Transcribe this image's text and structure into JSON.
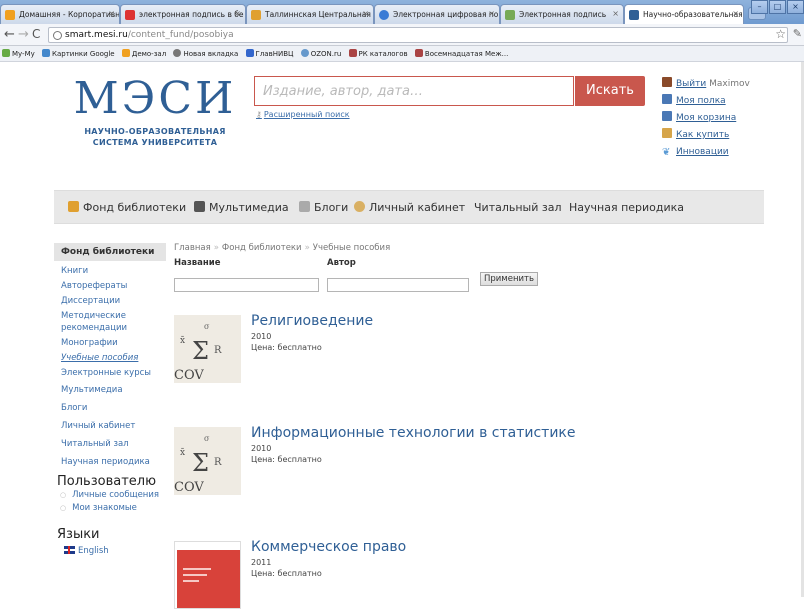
{
  "browser": {
    "tabs": [
      {
        "label": "Домашняя - Корпоративны",
        "color": "#f0a020"
      },
      {
        "label": "электронная подпись в бе",
        "color": "#d33"
      },
      {
        "label": "Таллиннская Центральная",
        "color": "#e0a030"
      },
      {
        "label": "Электронная цифровая по",
        "color": "#3a7bd5"
      },
      {
        "label": "Электронная подпись",
        "color": "#7a5"
      },
      {
        "label": "Научно-образовательная с",
        "color": "#2f5f95"
      }
    ],
    "url_host": "smart.mesi.ru",
    "url_path": "/content_fund/posobiya",
    "bookmarks": [
      {
        "label": "My-My",
        "color": "#6a4"
      },
      {
        "label": "Картинки Google",
        "color": "#48c"
      },
      {
        "label": "Демо-зал",
        "color": "#f0a020"
      },
      {
        "label": "Новая вкладка",
        "color": "#777"
      },
      {
        "label": "ГлавНИВЦ",
        "color": "#36c"
      },
      {
        "label": "OZON.ru",
        "color": "#69c"
      },
      {
        "label": "РК каталогов",
        "color": "#a44"
      },
      {
        "label": "Восемнадцатая Меж...",
        "color": "#a44"
      }
    ]
  },
  "logo": {
    "title": "МЭСИ",
    "subtitle_line1": "НАУЧНО-ОБРАЗОВАТЕЛЬНАЯ",
    "subtitle_line2": "СИСТЕМА УНИВЕРСИТЕТА"
  },
  "search": {
    "placeholder": "Издание, автор, дата…",
    "button": "Искать",
    "advanced": "Расширенный поиск"
  },
  "user": {
    "logout": "Выйти",
    "username": "Maximov",
    "links": [
      "Моя полка",
      "Моя корзина",
      "Как купить",
      "Инновации"
    ]
  },
  "menu": [
    "Фонд библиотеки",
    "Мультимедиа",
    "Блоги",
    "Личный кабинет",
    "Читальный зал",
    "Научная периодика"
  ],
  "sidebar": {
    "head": "Фонд библиотеки",
    "sub": [
      "Книги",
      "Авторефераты",
      "Диссертации",
      "Методические рекомендации",
      "Монографии",
      "Учебные пособия",
      "Электронные курсы"
    ],
    "top": [
      "Мультимедиа",
      "Блоги",
      "Личный кабинет",
      "Читальный зал",
      "Научная периодика"
    ],
    "user_section": "Пользователю",
    "user_items": [
      "Личные сообщения",
      "Мои знакомые"
    ],
    "lang_section": "Языки",
    "lang_english": "English"
  },
  "content": {
    "crumbs": [
      "Главная",
      "Фонд библиотеки",
      "Учебные пособия"
    ],
    "filter_title": "Название",
    "filter_author": "Автор",
    "apply": "Применить",
    "books": [
      {
        "title": "Религиоведение",
        "year": "2010",
        "price": "Цена: бесплатно"
      },
      {
        "title": "Информационные технологии в статистике",
        "year": "2010",
        "price": "Цена: бесплатно"
      },
      {
        "title": "Коммерческое право",
        "year": "2011",
        "price": "Цена: бесплатно"
      }
    ]
  }
}
